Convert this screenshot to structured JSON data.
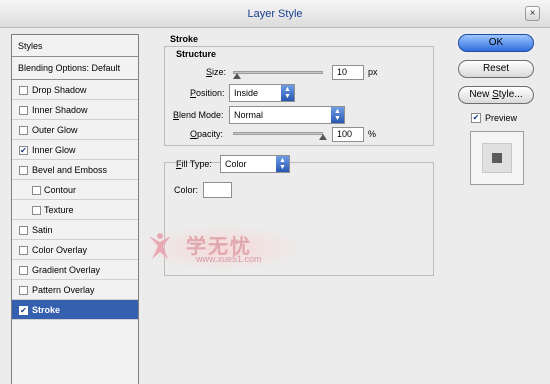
{
  "window": {
    "title": "Layer Style",
    "close_glyph": "×"
  },
  "styles_panel": {
    "header": "Styles",
    "blending_options": "Blending Options: Default",
    "items": [
      {
        "label": "Drop Shadow",
        "checked": false,
        "sub": false
      },
      {
        "label": "Inner Shadow",
        "checked": false,
        "sub": false
      },
      {
        "label": "Outer Glow",
        "checked": false,
        "sub": false
      },
      {
        "label": "Inner Glow",
        "checked": true,
        "sub": false
      },
      {
        "label": "Bevel and Emboss",
        "checked": false,
        "sub": false
      },
      {
        "label": "Contour",
        "checked": false,
        "sub": true
      },
      {
        "label": "Texture",
        "checked": false,
        "sub": true
      },
      {
        "label": "Satin",
        "checked": false,
        "sub": false
      },
      {
        "label": "Color Overlay",
        "checked": false,
        "sub": false
      },
      {
        "label": "Gradient Overlay",
        "checked": false,
        "sub": false
      },
      {
        "label": "Pattern Overlay",
        "checked": false,
        "sub": false
      },
      {
        "label": "Stroke",
        "checked": true,
        "sub": false,
        "active": true
      }
    ]
  },
  "stroke": {
    "section_title": "Stroke",
    "structure_title": "Structure",
    "size_label": "Size:",
    "size_value": "10",
    "size_unit": "px",
    "position_label": "Position:",
    "position_value": "Inside",
    "blend_mode_label": "Blend Mode:",
    "blend_mode_value": "Normal",
    "opacity_label": "Opacity:",
    "opacity_value": "100",
    "opacity_unit": "%",
    "fill_type_label": "Fill Type:",
    "fill_type_value": "Color",
    "color_label": "Color:"
  },
  "buttons": {
    "ok": "OK",
    "reset": "Reset",
    "new_style": "New Style..."
  },
  "preview": {
    "label": "Preview",
    "checked": true
  },
  "watermark": {
    "text": "学无忧",
    "url": "www.xue51.com"
  },
  "glyphs": {
    "check": "✔",
    "up_down": "▲▼"
  },
  "colors": {
    "title": "#1b3f92",
    "active_row": "#3560b0",
    "ok_button": "#2f6ede"
  }
}
